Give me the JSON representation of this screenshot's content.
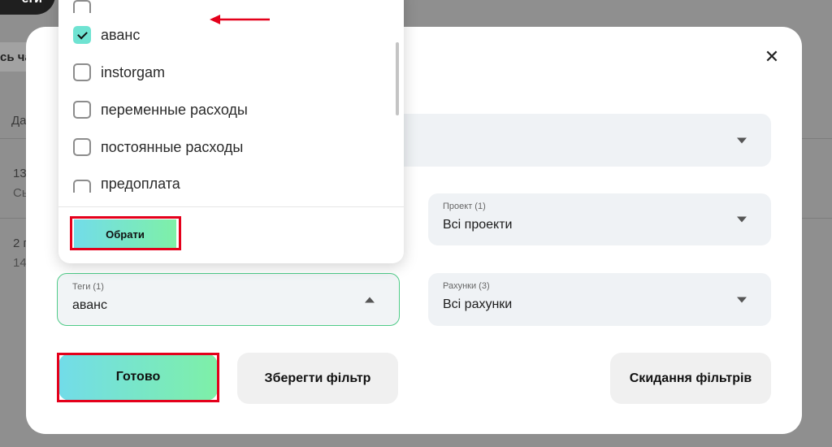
{
  "background": {
    "top_button_label": "еги",
    "chip_label": "сь ча",
    "row_header": "Да",
    "row1": {
      "line1": "13",
      "line2": "Сь"
    },
    "row2": {
      "line1": "2 г",
      "line2": "14"
    }
  },
  "modal": {
    "close_icon": "close-icon",
    "filters": {
      "top_select": {
        "label": "",
        "value": ""
      },
      "project": {
        "label": "Проект (1)",
        "value": "Всі проекти"
      },
      "tags": {
        "label": "Теги (1)",
        "value": "аванс"
      },
      "accounts": {
        "label": "Рахунки (3)",
        "value": "Всі рахунки"
      }
    },
    "buttons": {
      "done": "Готово",
      "save_filter": "Зберегти фільтр",
      "reset_filters": "Скидання фільтрів"
    }
  },
  "tag_dropdown": {
    "options": [
      {
        "label": "аванс",
        "checked": true
      },
      {
        "label": "instorgam",
        "checked": false
      },
      {
        "label": "переменные расходы",
        "checked": false
      },
      {
        "label": "постоянные расходы",
        "checked": false
      },
      {
        "label": "предоплата",
        "checked": false
      }
    ],
    "select_button": "Обрати"
  },
  "colors": {
    "accent_gradient_start": "#72dce9",
    "accent_gradient_end": "#7ef0a7",
    "highlight_red": "#e4001b",
    "checkbox_checked": "#6fe3d2",
    "active_border": "#4fcb88"
  }
}
